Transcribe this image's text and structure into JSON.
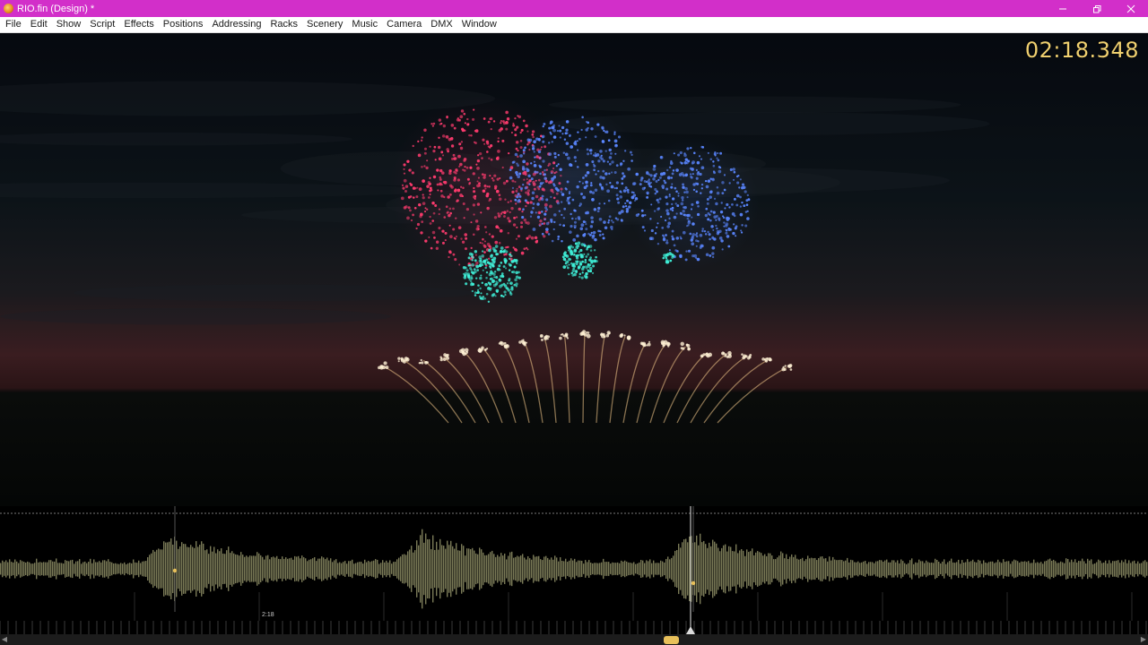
{
  "window": {
    "title": "RIO.fin (Design) *",
    "controls": {
      "minimize": "minimize-icon",
      "restore": "restore-icon",
      "close": "close-icon"
    }
  },
  "menu": {
    "items": [
      {
        "label": "File"
      },
      {
        "label": "Edit"
      },
      {
        "label": "Show"
      },
      {
        "label": "Script"
      },
      {
        "label": "Effects"
      },
      {
        "label": "Positions"
      },
      {
        "label": "Addressing"
      },
      {
        "label": "Racks"
      },
      {
        "label": "Scenery"
      },
      {
        "label": "Music"
      },
      {
        "label": "Camera"
      },
      {
        "label": "DMX"
      },
      {
        "label": "Window"
      }
    ]
  },
  "viewport": {
    "timecode": "02:18.348",
    "colors": {
      "sky_top": "#070b12",
      "sky_horizon": "#3a1a1c",
      "water": "#050806",
      "shell_red": "#ff3b6e",
      "shell_blue": "#5a86ff",
      "shell_cyan": "#3ff0d8",
      "fountain_gold": "#f2c88a"
    }
  },
  "timeline": {
    "time_label": "2:18",
    "colors": {
      "waveform": "#8f8f66",
      "cue": "#e8c05a",
      "playhead": "#e8e8e8",
      "scroll_thumb": "#e8c05a"
    }
  },
  "scrollbar": {
    "left_arrow": "◀",
    "right_arrow": "▶"
  }
}
